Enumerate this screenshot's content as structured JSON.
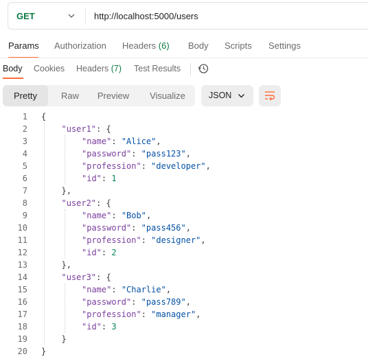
{
  "request": {
    "method": "GET",
    "url": "http://localhost:5000/users"
  },
  "request_tabs": [
    {
      "label": "Params",
      "count": ""
    },
    {
      "label": "Authorization",
      "count": ""
    },
    {
      "label": "Headers",
      "count": "(6)"
    },
    {
      "label": "Body",
      "count": ""
    },
    {
      "label": "Scripts",
      "count": ""
    },
    {
      "label": "Settings",
      "count": ""
    }
  ],
  "response_tabs": [
    {
      "label": "Body",
      "count": ""
    },
    {
      "label": "Cookies",
      "count": ""
    },
    {
      "label": "Headers",
      "count": "(7)"
    },
    {
      "label": "Test Results",
      "count": ""
    }
  ],
  "view_modes": [
    "Pretty",
    "Raw",
    "Preview",
    "Visualize"
  ],
  "format": "JSON",
  "icons": {
    "history": "history-icon",
    "wrap": "wrap-lines-icon",
    "chevron": "chevron-down-icon"
  },
  "colors": {
    "accent": "#ff6c37",
    "method": "#0c7a43",
    "json_key": "#7a3e9d",
    "json_string": "#0451a5",
    "json_number": "#098658"
  },
  "code_lines": [
    {
      "n": "1",
      "indent": 0,
      "tokens": [
        {
          "t": "pun",
          "v": "{"
        }
      ]
    },
    {
      "n": "2",
      "indent": 1,
      "tokens": [
        {
          "t": "key",
          "v": "\"user1\""
        },
        {
          "t": "pun",
          "v": ": {"
        }
      ]
    },
    {
      "n": "3",
      "indent": 2,
      "tokens": [
        {
          "t": "key",
          "v": "\"name\""
        },
        {
          "t": "pun",
          "v": ": "
        },
        {
          "t": "str",
          "v": "\"Alice\""
        },
        {
          "t": "pun",
          "v": ","
        }
      ]
    },
    {
      "n": "4",
      "indent": 2,
      "tokens": [
        {
          "t": "key",
          "v": "\"password\""
        },
        {
          "t": "pun",
          "v": ": "
        },
        {
          "t": "str",
          "v": "\"pass123\""
        },
        {
          "t": "pun",
          "v": ","
        }
      ]
    },
    {
      "n": "5",
      "indent": 2,
      "tokens": [
        {
          "t": "key",
          "v": "\"profession\""
        },
        {
          "t": "pun",
          "v": ": "
        },
        {
          "t": "str",
          "v": "\"developer\""
        },
        {
          "t": "pun",
          "v": ","
        }
      ]
    },
    {
      "n": "6",
      "indent": 2,
      "tokens": [
        {
          "t": "key",
          "v": "\"id\""
        },
        {
          "t": "pun",
          "v": ": "
        },
        {
          "t": "num",
          "v": "1"
        }
      ]
    },
    {
      "n": "7",
      "indent": 1,
      "tokens": [
        {
          "t": "pun",
          "v": "},"
        }
      ]
    },
    {
      "n": "8",
      "indent": 1,
      "tokens": [
        {
          "t": "key",
          "v": "\"user2\""
        },
        {
          "t": "pun",
          "v": ": {"
        }
      ]
    },
    {
      "n": "9",
      "indent": 2,
      "tokens": [
        {
          "t": "key",
          "v": "\"name\""
        },
        {
          "t": "pun",
          "v": ": "
        },
        {
          "t": "str",
          "v": "\"Bob\""
        },
        {
          "t": "pun",
          "v": ","
        }
      ]
    },
    {
      "n": "10",
      "indent": 2,
      "tokens": [
        {
          "t": "key",
          "v": "\"password\""
        },
        {
          "t": "pun",
          "v": ": "
        },
        {
          "t": "str",
          "v": "\"pass456\""
        },
        {
          "t": "pun",
          "v": ","
        }
      ]
    },
    {
      "n": "11",
      "indent": 2,
      "tokens": [
        {
          "t": "key",
          "v": "\"profession\""
        },
        {
          "t": "pun",
          "v": ": "
        },
        {
          "t": "str",
          "v": "\"designer\""
        },
        {
          "t": "pun",
          "v": ","
        }
      ]
    },
    {
      "n": "12",
      "indent": 2,
      "tokens": [
        {
          "t": "key",
          "v": "\"id\""
        },
        {
          "t": "pun",
          "v": ": "
        },
        {
          "t": "num",
          "v": "2"
        }
      ]
    },
    {
      "n": "13",
      "indent": 1,
      "tokens": [
        {
          "t": "pun",
          "v": "},"
        }
      ]
    },
    {
      "n": "14",
      "indent": 1,
      "tokens": [
        {
          "t": "key",
          "v": "\"user3\""
        },
        {
          "t": "pun",
          "v": ": {"
        }
      ]
    },
    {
      "n": "15",
      "indent": 2,
      "tokens": [
        {
          "t": "key",
          "v": "\"name\""
        },
        {
          "t": "pun",
          "v": ": "
        },
        {
          "t": "str",
          "v": "\"Charlie\""
        },
        {
          "t": "pun",
          "v": ","
        }
      ]
    },
    {
      "n": "16",
      "indent": 2,
      "tokens": [
        {
          "t": "key",
          "v": "\"password\""
        },
        {
          "t": "pun",
          "v": ": "
        },
        {
          "t": "str",
          "v": "\"pass789\""
        },
        {
          "t": "pun",
          "v": ","
        }
      ]
    },
    {
      "n": "17",
      "indent": 2,
      "tokens": [
        {
          "t": "key",
          "v": "\"profession\""
        },
        {
          "t": "pun",
          "v": ": "
        },
        {
          "t": "str",
          "v": "\"manager\""
        },
        {
          "t": "pun",
          "v": ","
        }
      ]
    },
    {
      "n": "18",
      "indent": 2,
      "tokens": [
        {
          "t": "key",
          "v": "\"id\""
        },
        {
          "t": "pun",
          "v": ": "
        },
        {
          "t": "num",
          "v": "3"
        }
      ]
    },
    {
      "n": "19",
      "indent": 1,
      "tokens": [
        {
          "t": "pun",
          "v": "}"
        }
      ]
    },
    {
      "n": "20",
      "indent": 0,
      "tokens": [
        {
          "t": "pun",
          "v": "}"
        }
      ]
    }
  ]
}
